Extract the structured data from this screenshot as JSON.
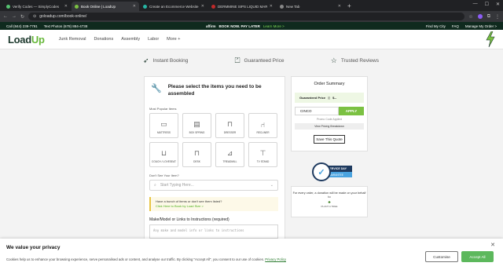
{
  "browser": {
    "tabs": [
      {
        "label": "Verify Codes — SimplyCodes",
        "color": "#56c271",
        "active": false
      },
      {
        "label": "Book Online | LoadUp",
        "color": "#7bc142",
        "active": true
      },
      {
        "label": "Create an Ecommerce Website",
        "color": "#26b5a3",
        "active": false
      },
      {
        "label": "DERMMINE SIPS LIQUID MARB",
        "color": "#c02a2a",
        "active": false
      },
      {
        "label": "New Tab",
        "color": "#888888",
        "active": false
      }
    ],
    "new_tab": "+",
    "url": "goloadup.com/book-online/"
  },
  "infobar": {
    "call": "Call (844) 239-7791",
    "text": "Text Photos (678) 884-4738",
    "promo_brand": "affirm",
    "promo_main": "BOOK NOW. PAY LATER",
    "promo_link": "Learn More >",
    "find_city": "Find My City",
    "faq": "FAQ",
    "manage": "Manage My Order >"
  },
  "header": {
    "logo_a": "Load",
    "logo_b": "Up",
    "nav": [
      "Junk Removal",
      "Donations",
      "Assembly",
      "Labor",
      "More +"
    ]
  },
  "steps": [
    "Instant Booking",
    "Guaranteed Price",
    "Trusted Reviews"
  ],
  "card": {
    "title": "Please select the items you need to be assembled",
    "popular_label": "Most Popular Items",
    "items": [
      "MATTRESS",
      "BOX SPRING",
      "DRESSER",
      "RECLINER",
      "COUCH / LOVESEAT",
      "DESK",
      "TREADMILL",
      "TV STAND"
    ],
    "dont_see": "Don't See Your Item?",
    "search_placeholder": "Start Typing Here...",
    "callout_text": "Have a bunch of items or don't see them listed?",
    "callout_link": "Click Here to Book by Load Size >",
    "make_label": "Make/Model or Links to Instructions (required)",
    "make_placeholder": "Any make and model info or links to instructions"
  },
  "summary": {
    "title": "Order Summary",
    "price_label": "Guaranteed Price",
    "price_value": "$--",
    "promo_code": "CINCO",
    "apply": "APPLY",
    "promo_status": "Promo Code Applied",
    "breakdown": "View Pricing Breakdown",
    "save": "Save This Quote"
  },
  "badge": {
    "line1": "SERVICE DAY",
    "line2": "GUARANTEE"
  },
  "donate": {
    "text": "For every order, a donation will be made on your behalf to",
    "org": "PLANT A TREE"
  },
  "cookie": {
    "title": "We value your privacy",
    "text": "Cookies help us to enhance your browsing experience, serve personalised ads or content, and analyse our traffic. By clicking \"Accept All\", you consent to our use of cookies.",
    "policy": "Privacy Policy",
    "customise": "Customise",
    "accept": "Accept All",
    "close": "✕"
  },
  "colors": {
    "brand_green": "#7bc142",
    "brand_dark": "#1e3a2e"
  }
}
